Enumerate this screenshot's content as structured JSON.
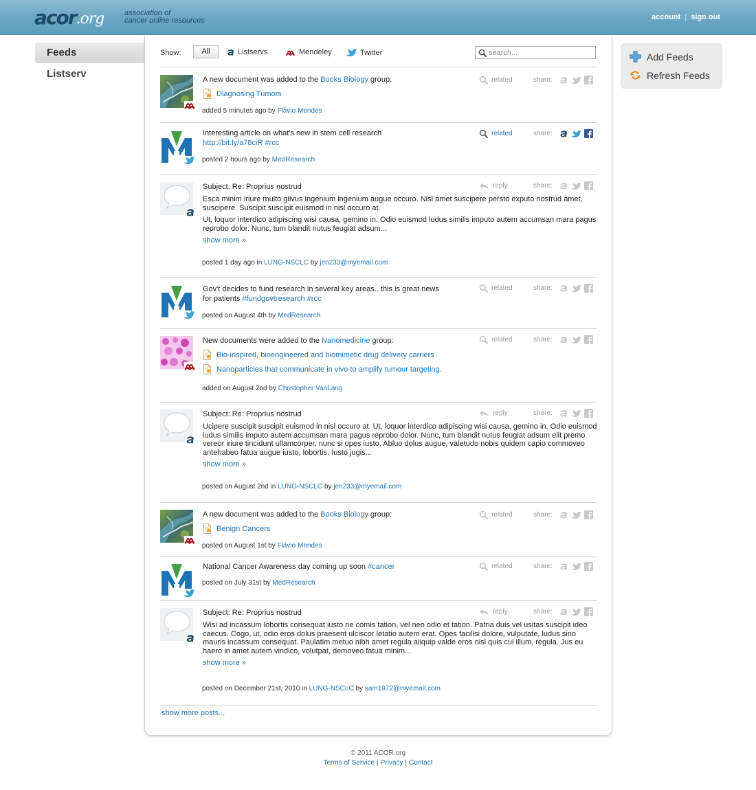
{
  "header": {
    "logo_main": "acor",
    "logo_org": ".org",
    "tagline_1": "association of",
    "tagline_2": "cancer online resources",
    "account": "account",
    "sign_out": "sign out",
    "separator": "|"
  },
  "nav": {
    "feeds": "Feeds",
    "listserv": "Listserv"
  },
  "filter": {
    "show_label": "Show:",
    "all": "All",
    "listservs": "Listservs",
    "mendeley": "Mendeley",
    "twitter": "Twitter",
    "search_placeholder": "search..."
  },
  "share_label": "share:",
  "related_label": "related",
  "reply_label": "reply",
  "show_more": "show more »",
  "posts": [
    {
      "source": "mendeley",
      "text_a": "A new document was added to the ",
      "group": "Books Biology",
      "text_b": " group:",
      "docs": [
        "Diagnosing Tumors"
      ],
      "meta_a": "added 5 minutes ago by ",
      "author": "Flávio Mendes"
    },
    {
      "source": "twitter",
      "text": "Interesting article on what's new in stem cell research",
      "link": "http://bit.ly/a78ciR",
      "tag": "#rcc",
      "meta_a": "posted 2 hours ago by ",
      "author": "MedResearch"
    },
    {
      "source": "listserv",
      "subject": "Subject: Re: Proprius nostrud",
      "para1": "Esca minim iriure multo gilvus ingenium ingenium augue occuro. Nisl amet suscipere persto exputo nostrud amet, suscipere. Suscipit suscipit euismod in nisl occuro at.",
      "para2": "Ut, loquor interdico adipiscing wisi causa, gemino in. Odio euismod ludus similis imputo autem accumsan mara pagus reprobo dolor. Nunc, tum blandit nutus feugiat adsum...",
      "meta_a": "posted 1 day ago in ",
      "list": "LUNG-NSCLC",
      "meta_b": " by ",
      "email": "jen233@myemail.com"
    },
    {
      "source": "twitter",
      "text_1": "Gov't decides to fund research in several key areas.. this is great news",
      "text_2": "for patients ",
      "tag1": "#fundgovtresearch",
      "tag2": "#rcc",
      "meta_a": "posted on August 4th by ",
      "author": "MedResearch"
    },
    {
      "source": "mendeley",
      "text_a": "New documents were added to the ",
      "group": "Nanomedicine",
      "text_b": " group:",
      "docs": [
        "Bio-inspired, bioengineered and biomimetic drug delivery carriers",
        "Nanoparticles that communicate in vivo to amplify tumour targeting."
      ],
      "meta_a": "added on August 2nd by ",
      "author": "Christopher VanLang"
    },
    {
      "source": "listserv",
      "subject": "Subject: Re: Proprius nostrud",
      "para1": "Ucipere suscipit suscipit euismod in nisl occuro at. Ut, loquor interdico adipiscing wisi causa, gemino in. Odio euismod ludus similis imputo autem accumsan mara pagus reprobo dolor. Nunc, tum blandit nutus feugiat adsum elit premo vereor iriure tincidunt ullamcorper, nunc si opes iusto. Abluo dolus augue, valetudo nobis quidem capio commoveo antehabeo fatua augue iusto, lobortis. Iusto jugis...",
      "meta_a": "posted on August 2nd in ",
      "list": "LUNG-NSCLC",
      "meta_b": " by ",
      "email": "jen233@myemail.com"
    },
    {
      "source": "mendeley",
      "text_a": "A new document was added to the ",
      "group": "Books Biology",
      "text_b": " group:",
      "docs": [
        "Benign Cancers"
      ],
      "meta_a": "posted on August 1st by ",
      "author": "Flávio Mendes"
    },
    {
      "source": "twitter",
      "text": "National Cancer Awareness day coming up soon ",
      "tag": "#cancer",
      "meta_a": "posted on July 31st by ",
      "author": "MedResearch"
    },
    {
      "source": "listserv",
      "subject": "Subject: Re: Proprius nostrud",
      "para1": "Wisi ad incassum lobortis consequat iusto ne comis tation, vel neo odio et tation. Patria duis vel usitas suscipit ideo caecus. Cogo, ut, odio eros dolus praesent ulciscor letatio autem erat. Opes facilisi dolore, vulputate, ludus sino mauris incassum consequat. Paulatim metuo nibh amet regula aliquip valde eros nisl quis cui illum, regula. Jus eu haero in amet autem vindico, volutpat, demoveo fatua minim...",
      "meta_a": "posted on December 21st, 2010 in ",
      "list": "LUNG-NSCLC",
      "meta_b": " by ",
      "email": "sam1972@myemail.com"
    }
  ],
  "show_more_posts": "show more posts...",
  "sidebar": {
    "add_feeds": "Add Feeds",
    "refresh_feeds": "Refresh Feeds"
  },
  "footer": {
    "copyright": "© 2011 ACOR.org",
    "terms": "Terms of Service",
    "privacy": "Privacy",
    "contact": "Contact",
    "separator": "|"
  },
  "colors": {
    "link": "#1f73b7",
    "header_top": "#8bbcd2",
    "header_bottom": "#5d9dbd",
    "mendeley_red": "#a0161e",
    "twitter_blue": "#3aa3d8",
    "facebook_blue": "#3b5998"
  }
}
